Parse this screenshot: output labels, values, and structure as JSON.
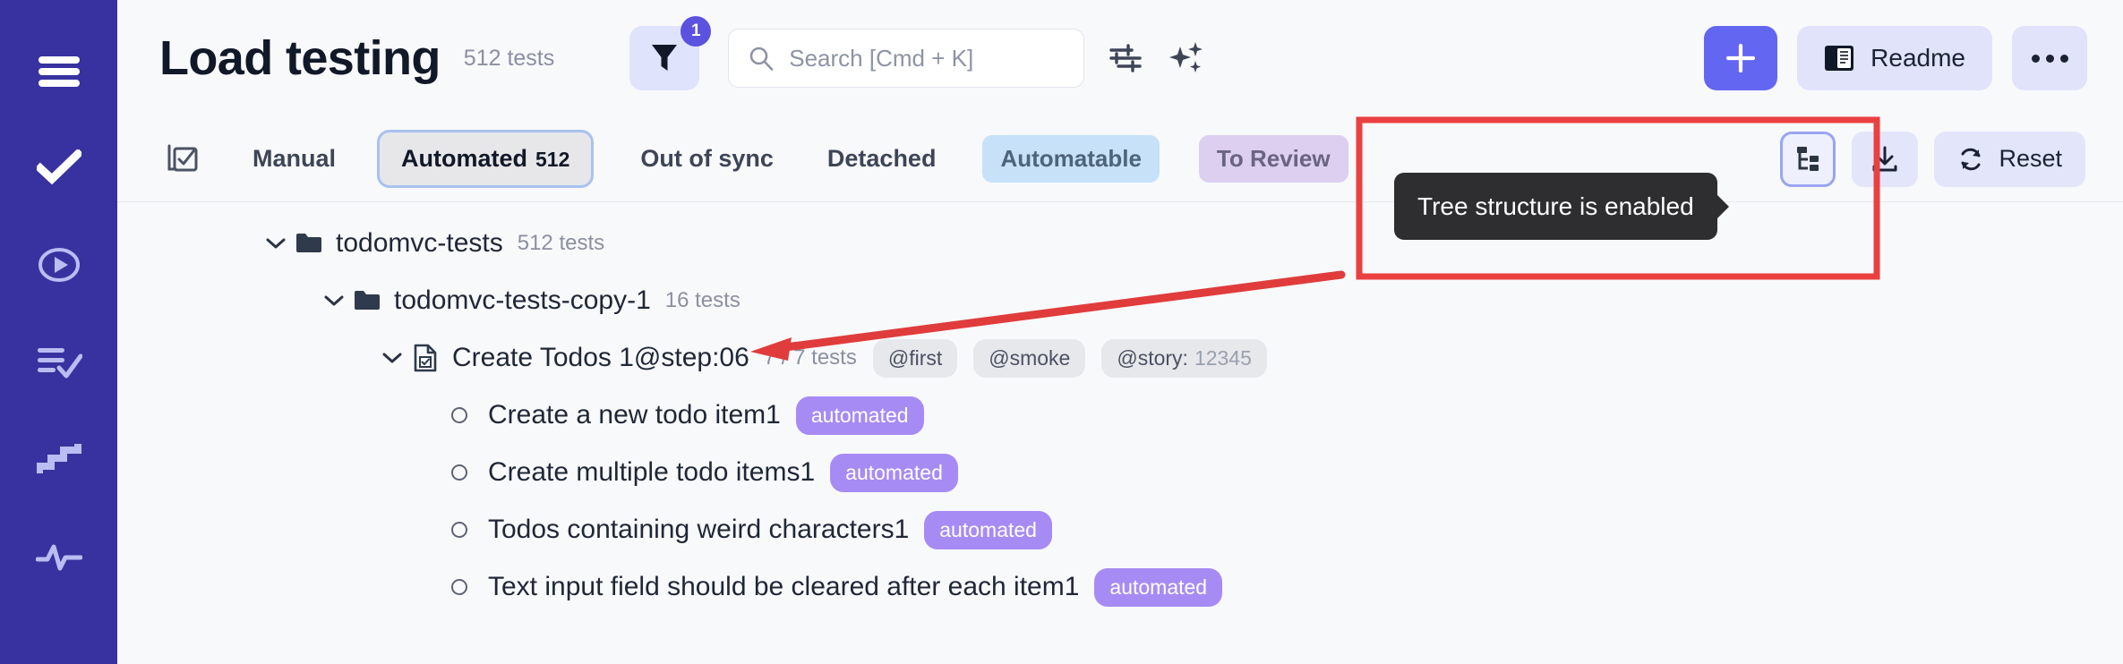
{
  "sidebar": {
    "items": [
      {
        "name": "menu-icon",
        "label": "Menu"
      },
      {
        "name": "check-icon",
        "label": "Tests"
      },
      {
        "name": "play-circle-icon",
        "label": "Runs"
      },
      {
        "name": "list-check-icon",
        "label": "Plans"
      },
      {
        "name": "steps-icon",
        "label": "Steps"
      },
      {
        "name": "activity-icon",
        "label": "Activity"
      }
    ]
  },
  "header": {
    "title": "Load testing",
    "tests_count": "512 tests",
    "filter_badge": "1",
    "search": {
      "placeholder": "Search [Cmd + K]",
      "value": ""
    },
    "settings_icon_label": "sliders-icon",
    "ai_icon_label": "sparkles-icon",
    "add_label": "+",
    "readme_label": "Readme",
    "more_label": "•••"
  },
  "tabs": {
    "lead_icon_label": "checklist-icon",
    "items": [
      {
        "label": "Manual",
        "count": "",
        "type": "text",
        "active": false
      },
      {
        "label": "Automated",
        "count": "512",
        "type": "text",
        "active": true
      },
      {
        "label": "Out of sync",
        "count": "",
        "type": "text",
        "active": false
      },
      {
        "label": "Detached",
        "count": "",
        "type": "text",
        "active": false
      },
      {
        "label": "Automatable",
        "count": "",
        "type": "pill-blue",
        "active": false
      },
      {
        "label": "To Review",
        "count": "",
        "type": "pill-purple",
        "active": false
      }
    ],
    "tree_toggle_label": "tree-structure-toggle",
    "download_label": "download-icon",
    "reset_label": "Reset"
  },
  "tooltip": {
    "text": "Tree structure is enabled"
  },
  "tree": {
    "rows": [
      {
        "kind": "folder",
        "indent": 0,
        "expanded": true,
        "label": "todomvc-tests",
        "count": "512 tests",
        "tags": [],
        "badge": ""
      },
      {
        "kind": "folder",
        "indent": 1,
        "expanded": true,
        "label": "todomvc-tests-copy-1",
        "count": "16 tests",
        "tags": [],
        "badge": ""
      },
      {
        "kind": "file",
        "indent": 2,
        "expanded": true,
        "label": "Create Todos 1@step:06",
        "count": "7 / 7 tests",
        "tags": [
          {
            "key": "@first",
            "val": ""
          },
          {
            "key": "@smoke",
            "val": ""
          },
          {
            "key": "@story:",
            "val": "12345"
          }
        ],
        "badge": ""
      },
      {
        "kind": "test",
        "indent": 3,
        "expanded": false,
        "label": "Create a new todo item1",
        "count": "",
        "tags": [],
        "badge": "automated"
      },
      {
        "kind": "test",
        "indent": 3,
        "expanded": false,
        "label": "Create multiple todo items1",
        "count": "",
        "tags": [],
        "badge": "automated"
      },
      {
        "kind": "test",
        "indent": 3,
        "expanded": false,
        "label": "Todos containing weird characters1",
        "count": "",
        "tags": [],
        "badge": "automated"
      },
      {
        "kind": "test",
        "indent": 3,
        "expanded": false,
        "label": "Text input field should be cleared after each item1",
        "count": "",
        "tags": [],
        "badge": "automated"
      }
    ]
  },
  "annotation": {
    "box_color": "#ea4040",
    "arrow_color": "#e03c3c"
  },
  "colors": {
    "sidebar": "#3832a0",
    "accent": "#6366f1",
    "badge_purple": "#a78bf5",
    "pill_blue_bg": "#c7e1f9",
    "pill_purple_bg": "#dccff0",
    "tooltip_bg": "#2e2e30",
    "page_bg": "#f8f9fb"
  }
}
